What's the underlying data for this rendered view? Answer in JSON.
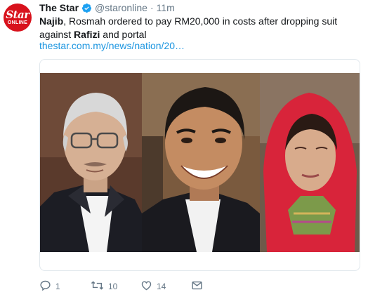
{
  "tweet": {
    "avatar": {
      "line1": "Star",
      "line2": "ONLINE",
      "brand_color": "#d8121c"
    },
    "author_name": "The Star",
    "handle": "@staronline",
    "separator": "·",
    "time": "11m",
    "text_part1": "Najib",
    "text_part2": ", Rosmah ordered to pay RM20,000 in costs after dropping suit against ",
    "text_part3": "Rafizi",
    "text_part4": " and portal",
    "link": "thestar.com.my/news/nation/20…",
    "actions": {
      "reply_count": "1",
      "retweet_count": "10",
      "like_count": "14"
    }
  },
  "colors": {
    "link": "#1b95e0",
    "muted": "#657786",
    "verified": "#1da1f2"
  }
}
